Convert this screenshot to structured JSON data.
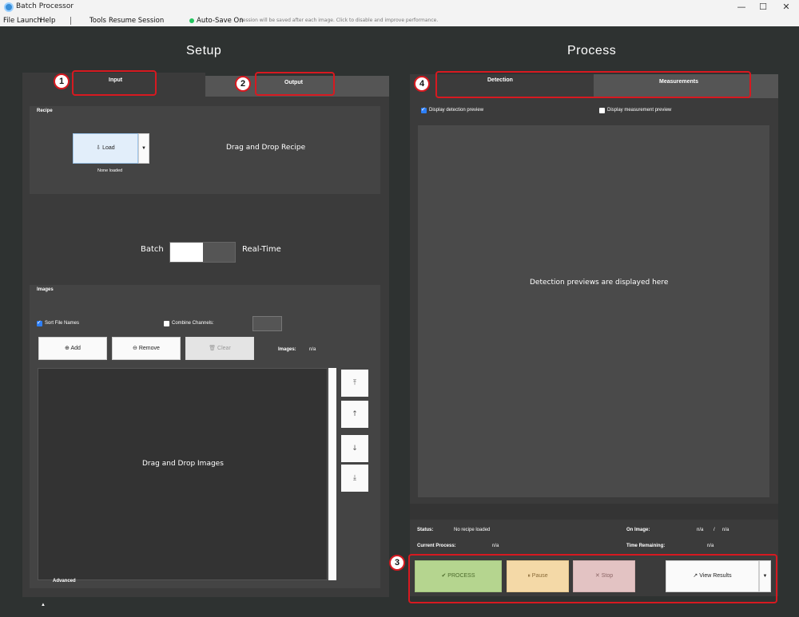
{
  "window": {
    "title": "Batch Processor",
    "minimize": "—",
    "maximize": "☐",
    "close": "✕"
  },
  "menu": {
    "file": "File",
    "launch": "Launch",
    "help": "Help",
    "tools": "Tools",
    "resume": "Resume Session",
    "autosave": "Auto-Save On",
    "autosave_note": "Session will be saved after each image. Click to disable and improve performance."
  },
  "setup": {
    "heading": "Setup",
    "tabs": {
      "input": "Input",
      "output": "Output"
    },
    "recipe": {
      "label": "Recipe",
      "load_button": "Load",
      "status": "None loaded",
      "drop_text": "Drag and Drop Recipe"
    },
    "mode": {
      "left": "Batch",
      "right": "Real-Time"
    },
    "images": {
      "label": "Images",
      "sort_label": "Sort File Names",
      "combine_label": "Combine Channels:",
      "add": "Add",
      "remove": "Remove",
      "clear": "Clear",
      "count_label": "Images:",
      "count_value": "n/a",
      "drop_text": "Drag and Drop Images"
    },
    "advanced": "Advanced"
  },
  "process": {
    "heading": "Process",
    "tabs": {
      "detection": "Detection",
      "measurements": "Measurements"
    },
    "display_detection": "Display detection preview",
    "display_measurement": "Display measurement preview",
    "preview_text": "Detection previews are displayed here",
    "status_label": "Status:",
    "status_value": "No recipe loaded",
    "current_label": "Current Process:",
    "current_value": "n/a",
    "on_image_label": "On Image:",
    "on_image_value": "n/a",
    "on_image_sep": "/",
    "on_image_total": "n/a",
    "time_label": "Time Remaining:",
    "time_value": "n/a",
    "buttons": {
      "process": "PROCESS",
      "pause": "Pause",
      "stop": "Stop",
      "view_results": "View Results"
    }
  },
  "callouts": [
    "1",
    "2",
    "3",
    "4"
  ],
  "colors": {
    "callout": "#d71920",
    "process_btn": "#b5d58f",
    "pause_btn": "#f4d9a7",
    "stop_btn": "#e3c3c3",
    "background": "#2e3231"
  }
}
